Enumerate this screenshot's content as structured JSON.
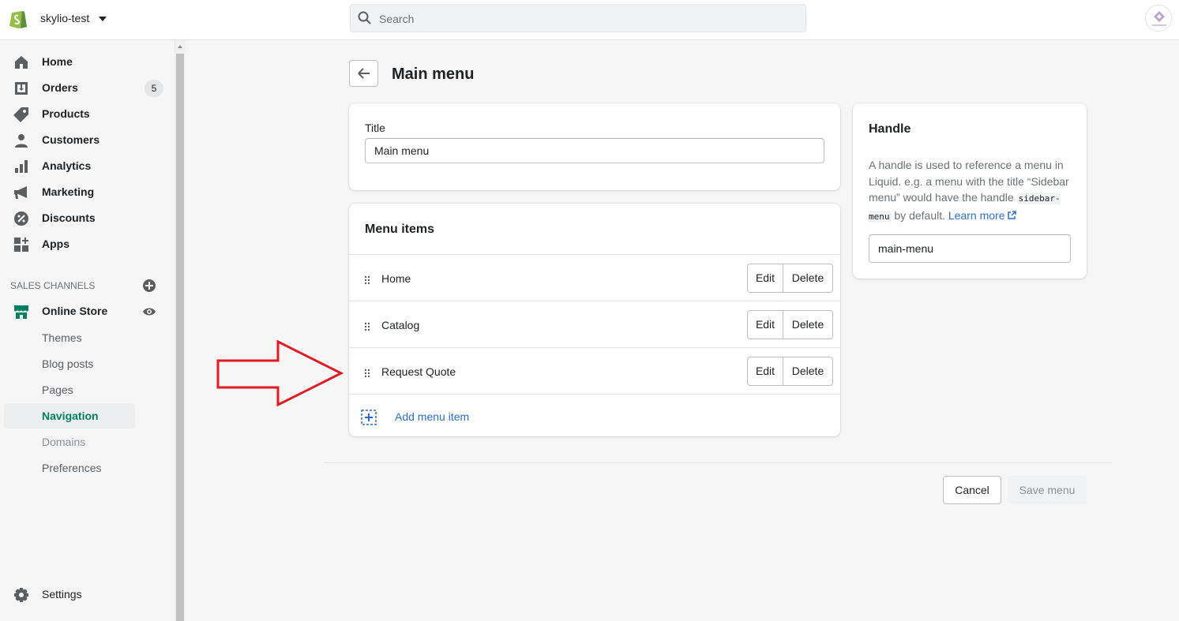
{
  "topbar": {
    "store_name": "skylio-test",
    "search_placeholder": "Search"
  },
  "sidebar": {
    "items": [
      {
        "label": "Home",
        "icon": "home-icon"
      },
      {
        "label": "Orders",
        "icon": "orders-icon",
        "badge": "5"
      },
      {
        "label": "Products",
        "icon": "tag-icon"
      },
      {
        "label": "Customers",
        "icon": "person-icon"
      },
      {
        "label": "Analytics",
        "icon": "bar-chart-icon"
      },
      {
        "label": "Marketing",
        "icon": "megaphone-icon"
      },
      {
        "label": "Discounts",
        "icon": "discount-icon"
      },
      {
        "label": "Apps",
        "icon": "apps-icon"
      }
    ],
    "sales_channels_label": "SALES CHANNELS",
    "online_store_label": "Online Store",
    "sub_items": [
      "Themes",
      "Blog posts",
      "Pages",
      "Navigation",
      "Domains",
      "Preferences"
    ],
    "active_sub_item": "Navigation",
    "settings_label": "Settings"
  },
  "page": {
    "title": "Main menu"
  },
  "title_card": {
    "label": "Title",
    "value": "Main menu"
  },
  "menu_card": {
    "heading": "Menu items",
    "items": [
      {
        "label": "Home",
        "edit": "Edit",
        "delete": "Delete"
      },
      {
        "label": "Catalog",
        "edit": "Edit",
        "delete": "Delete"
      },
      {
        "label": "Request Quote",
        "edit": "Edit",
        "delete": "Delete"
      }
    ],
    "add_label": "Add menu item"
  },
  "handle_card": {
    "title": "Handle",
    "desc_pre": "A handle is used to reference a menu in Liquid. e.g. a menu with the title “Sidebar menu” would have the handle ",
    "desc_code": "sidebar-menu",
    "desc_post": " by default. ",
    "learn_more": "Learn more",
    "value": "main-menu"
  },
  "footer": {
    "cancel": "Cancel",
    "save": "Save menu"
  },
  "colors": {
    "accent_green": "#008060",
    "link_blue": "#2c6ecb",
    "annotation_red": "#e31b23"
  }
}
